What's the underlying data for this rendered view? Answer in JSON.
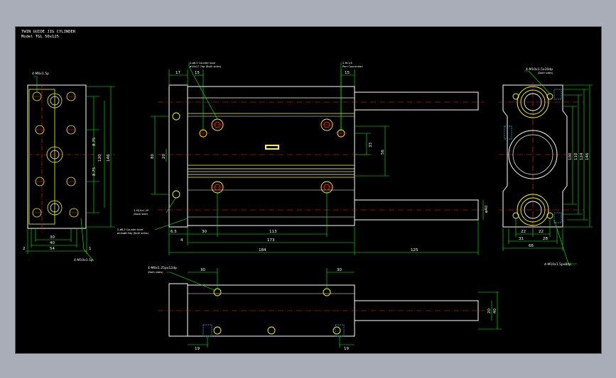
{
  "title": {
    "line1": "TWIN GUIDE JIG CYLINDER",
    "line2": "Model   TGL 50x125"
  },
  "colors": {
    "background": "#000000",
    "outline": "#ffffff",
    "dimension": "#00ff00",
    "centerline": "#ff2020",
    "hidden": "#00c8ff",
    "highlight": "#ffff00",
    "chrome": "#a9adb7"
  },
  "left_view": {
    "hole_note": "4-M6x1.5p",
    "bottom_note": "4-M10x1.5p",
    "dims": [
      "8.75",
      "120",
      "8.75",
      "146",
      "30",
      "40",
      "54",
      "2",
      "1"
    ]
  },
  "front_view": {
    "note_counterbore": "2-ø8.5 Counter bore",
    "note_counterbore_sub": "ø14x17.7dp (Both sides)",
    "note_port": "2-Rc1/4",
    "note_port_sub": "Port Connection",
    "note_m10": "3-M10x1.5P",
    "note_m10_sub": "(Back side)",
    "note_cb2": "2-ø8.5 Counter bore",
    "note_cb2_sub": "ø14xø8.5dp (Both sides)",
    "dims": {
      "d17": "17",
      "d15a": "15",
      "d15b": "15",
      "d80": "80",
      "d20": "20",
      "d33": "33",
      "d56": "56",
      "d6_5": "6.5",
      "d4": "4",
      "d30": "30",
      "d113": "113",
      "d173": "173",
      "d184": "184",
      "d125": "125",
      "d40": "ø40"
    }
  },
  "right_view": {
    "note_top": "4-M10x1.5x20dp",
    "note_top_sub": "(Both sides)",
    "note_bottom": "4-M10x1.5px8dp",
    "dims": [
      "100",
      "110",
      "124",
      "146",
      "22",
      "22",
      "31",
      "28",
      "66"
    ]
  },
  "bottom_view": {
    "note": "4-M6x1.25px12dp",
    "note_sub": "(Both sides)",
    "dims": {
      "d30a": "30",
      "d30b": "30",
      "d20": "20",
      "d40": "40",
      "d19a": "19",
      "d19b": "19"
    }
  }
}
